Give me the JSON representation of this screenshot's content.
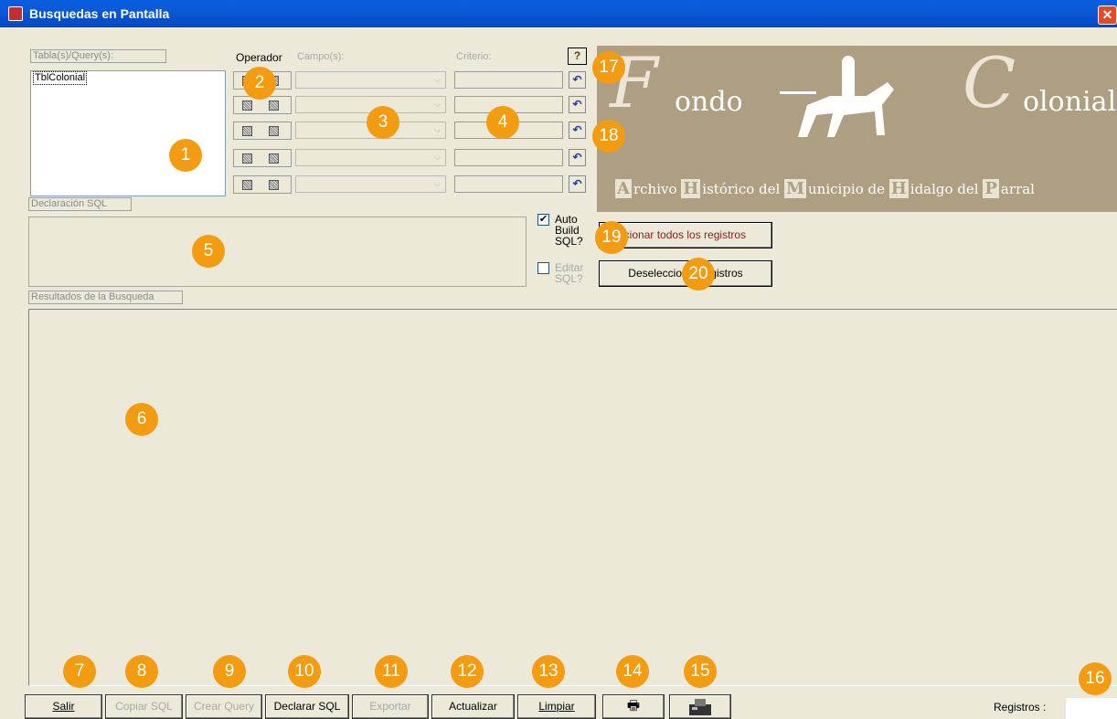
{
  "window": {
    "title": "Busquedas en Pantalla",
    "close_glyph": "✕"
  },
  "tables": {
    "label": "Tabla(s)/Query(s):",
    "items": [
      "TblColonial"
    ]
  },
  "operator": {
    "label": "Operador"
  },
  "fields": {
    "label": "Campo(s):"
  },
  "criteria": {
    "label": "Criterio:"
  },
  "help_glyph": "?",
  "undo_glyph": "↶",
  "combo_arrow": "⌵",
  "banner": {
    "word1": "ondo",
    "word2": "olonial",
    "cap1": "F",
    "cap2": "C",
    "subtitle": [
      {
        "cap": "A",
        "rest": "rchivo "
      },
      {
        "cap": "H",
        "rest": "istórico del "
      },
      {
        "cap": "M",
        "rest": "unicipio de "
      },
      {
        "cap": "H",
        "rest": "idalgo del "
      },
      {
        "cap": "P",
        "rest": "arral"
      }
    ]
  },
  "sql": {
    "label": "Declaración SQL"
  },
  "options": {
    "auto_build": {
      "line1": "Auto",
      "line2": "Build",
      "line3": "SQL?",
      "checked": true
    },
    "edit_sql": {
      "line1": "Editar",
      "line2": "SQL?",
      "checked": false
    }
  },
  "buttons": {
    "select_all": "eccionar todos los registros",
    "deselect_all": "Deseleccionar registros"
  },
  "results": {
    "label": "Resultados de la Busqueda"
  },
  "toolbar": {
    "salir": "Salir",
    "copiar_sql": "Copiar SQL",
    "crear_query": "Crear Query",
    "declarar_sql": "Declarar SQL",
    "exportar": "Exportar",
    "actualizar": "Actualizar",
    "limpiar": "Limpiar",
    "print_glyph": "🖶"
  },
  "status": {
    "registros_label": "Registros :",
    "registros_value": ""
  },
  "badges": [
    "1",
    "2",
    "3",
    "4",
    "5",
    "6",
    "7",
    "8",
    "9",
    "10",
    "11",
    "12",
    "13",
    "14",
    "15",
    "16",
    "17",
    "18",
    "19",
    "20"
  ],
  "colors": {
    "titlebar": "#0a58d6",
    "badge": "#f39c12",
    "banner": "#ae9f82",
    "face": "#ece9d8"
  }
}
